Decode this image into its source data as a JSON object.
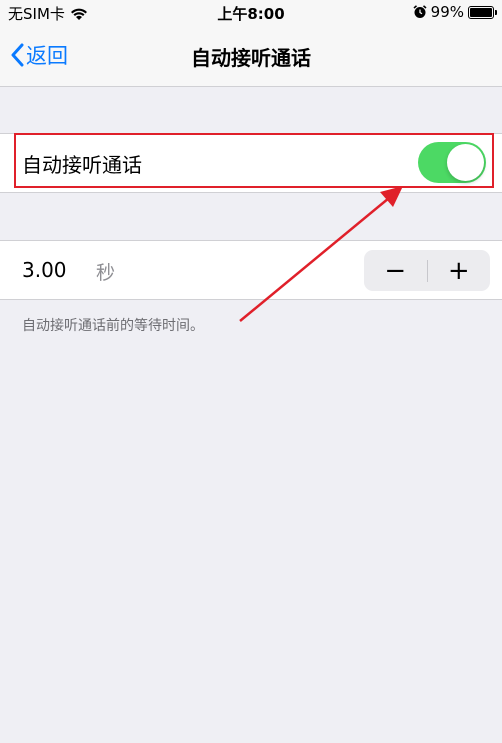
{
  "status_bar": {
    "carrier": "无SIM卡",
    "time": "上午8:00",
    "battery": "99%"
  },
  "nav": {
    "back_label": "返回",
    "title": "自动接听通话"
  },
  "auto_answer": {
    "label": "自动接听通话",
    "enabled": true
  },
  "wait_time": {
    "value": "3.00",
    "unit": "秒",
    "minus": "−",
    "plus": "+",
    "footnote": "自动接听通话前的等待时间。"
  },
  "colors": {
    "accent": "#0a7aff",
    "toggle_on": "#4cd964",
    "annotation": "#e0202a"
  },
  "icons": [
    "wifi-icon",
    "alarm-icon",
    "battery-icon",
    "chevron-left-icon",
    "annotation-arrow"
  ]
}
